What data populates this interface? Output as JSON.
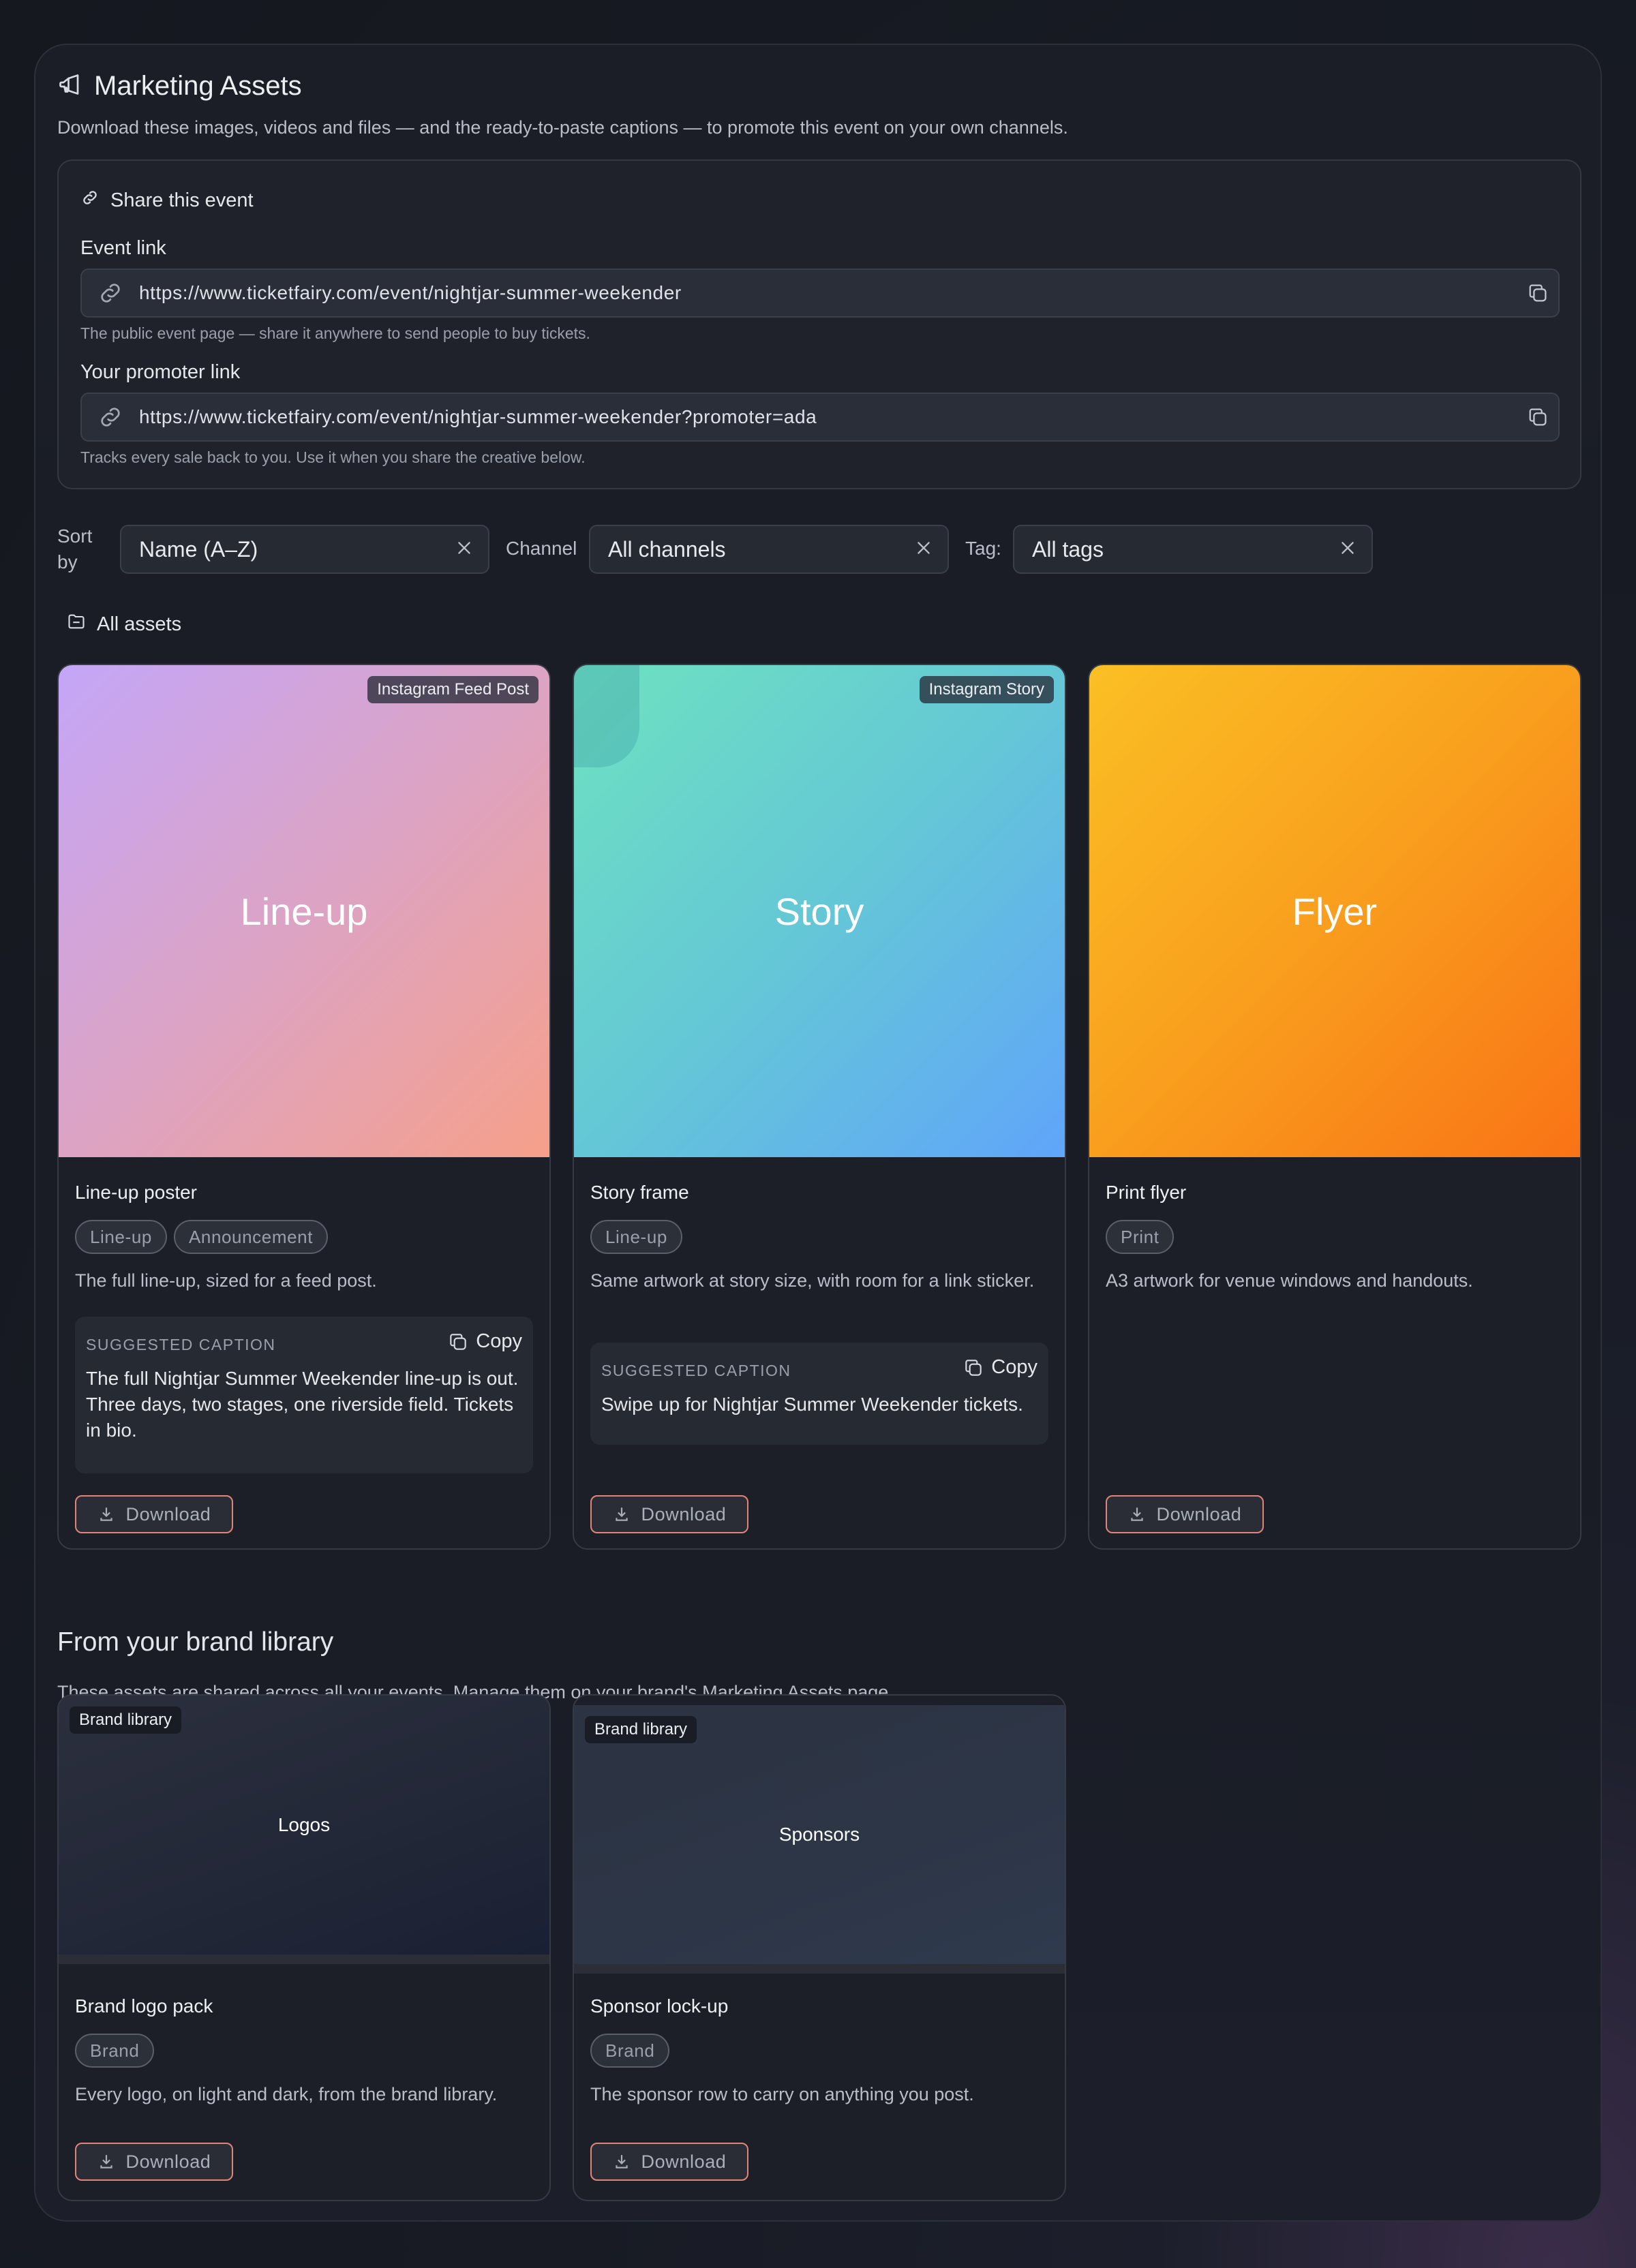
{
  "header": {
    "title": "Marketing Assets",
    "subtitle": "Download these images, videos and files — and the ready-to-paste captions — to promote this event on your own channels."
  },
  "share": {
    "heading": "Share this event",
    "event_link_label": "Event link",
    "event_link_value": "https://www.ticketfairy.com/event/nightjar-summer-weekender",
    "event_link_hint": "The public event page — share it anywhere to send people to buy tickets.",
    "promoter_link_label": "Your promoter link",
    "promoter_link_value": "https://www.ticketfairy.com/event/nightjar-summer-weekender?promoter=ada",
    "promoter_link_hint": "Tracks every sale back to you. Use it when you share the creative below."
  },
  "filters": {
    "sort_label_1": "Sort",
    "sort_label_2": "by",
    "sort_value": "Name (A–Z)",
    "channel_label": "Channel",
    "channel_value": "All channels",
    "tag_label": "Tag:",
    "tag_value": "All tags"
  },
  "all_assets_label": "All assets",
  "assets": [
    {
      "art_label": "Line-up",
      "badge": "Instagram Feed Post",
      "name": "Line-up poster",
      "tags": [
        "Line-up",
        "Announcement"
      ],
      "description": "The full line-up, sized for a feed post.",
      "caption_heading": "SUGGESTED CAPTION",
      "copy_label": "Copy",
      "caption": "The full Nightjar Summer Weekender line-up is out. Three days, two stages, one riverside field. Tickets in bio.",
      "download_label": "Download"
    },
    {
      "art_label": "Story",
      "badge": "Instagram Story",
      "name": "Story frame",
      "tags": [
        "Line-up"
      ],
      "description": "Same artwork at story size, with room for a link sticker.",
      "caption_heading": "SUGGESTED CAPTION",
      "copy_label": "Copy",
      "caption": "Swipe up for Nightjar Summer Weekender tickets.",
      "download_label": "Download"
    },
    {
      "art_label": "Flyer",
      "name": "Print flyer",
      "tags": [
        "Print"
      ],
      "description": "A3 artwork for venue windows and handouts.",
      "download_label": "Download"
    }
  ],
  "brand_section": {
    "title": "From your brand library",
    "subtitle": "These assets are shared across all your events. Manage them on your brand's Marketing Assets page."
  },
  "brand_assets": [
    {
      "art_label": "Logos",
      "badge": "Brand library",
      "name": "Brand logo pack",
      "tags": [
        "Brand"
      ],
      "description": "Every logo, on light and dark, from the brand library.",
      "download_label": "Download"
    },
    {
      "art_label": "Sponsors",
      "badge": "Brand library",
      "name": "Sponsor lock-up",
      "tags": [
        "Brand"
      ],
      "description": "The sponsor row to carry on anything you post.",
      "download_label": "Download"
    }
  ],
  "colors": {
    "lineup_gradient": [
      "#c4a6f8",
      "#f6a08a"
    ],
    "story_gradient": [
      "#6ee2c0",
      "#60a5fa"
    ],
    "flyer_gradient": [
      "#fbbf24",
      "#f97316"
    ],
    "download_border": "#e0857a"
  }
}
